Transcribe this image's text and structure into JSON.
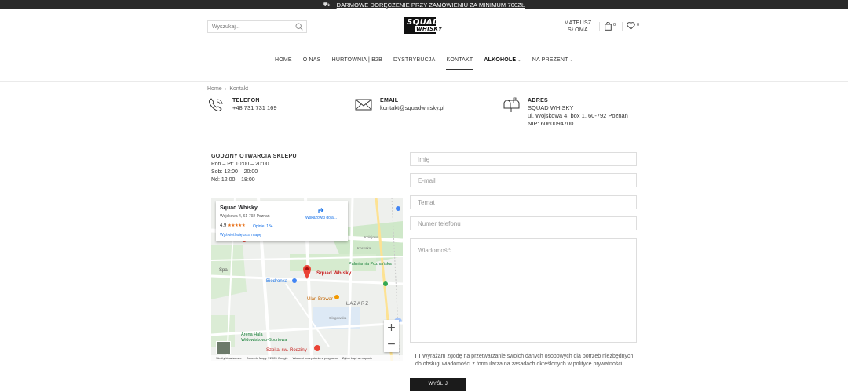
{
  "topbar": {
    "promo": "DARMOWE DORĘCZENIE PRZY ZAMÓWIENIU ZA MINIMUM 700ZŁ"
  },
  "header": {
    "search_placeholder": "Wyszukaj...",
    "logo": {
      "line1": "SQUAD",
      "line2": "WHISKY"
    },
    "user": {
      "first": "MATEUSZ",
      "last": "SŁOMA"
    },
    "cart_count": "0",
    "wishlist_count": "0"
  },
  "nav": [
    {
      "label": "HOME"
    },
    {
      "label": "O NAS"
    },
    {
      "label": "HURTOWNIA | B2B"
    },
    {
      "label": "DYSTRYBUCJA"
    },
    {
      "label": "KONTAKT"
    },
    {
      "label": "ALKOHOLE"
    },
    {
      "label": "NA PREZENT"
    }
  ],
  "breadcrumb": {
    "home": "Home",
    "current": "Kontakt"
  },
  "contact": {
    "phone": {
      "label": "TELEFON",
      "value": "+48 731 731 169"
    },
    "email": {
      "label": "EMAIL",
      "value": "kontakt@squadwhisky.pl"
    },
    "address": {
      "label": "ADRES",
      "line1": "SQUAD WHISKY",
      "line2": "ul. Wojskowa 4, box 1. 60-792 Poznań",
      "line3": "NIP: 6060094700"
    }
  },
  "hours": {
    "title": "GODZINY OTWARCIA SKLEPU",
    "l1": "Pon – Pt: 10:00 – 20:00",
    "l2": "Sob: 12:00 – 20:00",
    "l3": "Nd: 12:00 – 18:00"
  },
  "map": {
    "place": "Squad Whisky",
    "address": "Wojskowa 4, 61-792 Poznań",
    "rating": "4,9",
    "stars": "★★★★★",
    "reviews": "Opinie: 134",
    "bigger": "Wyświetl większą mapę",
    "directions": "Wskazówki doja...",
    "pin_label": "Squad Whisky",
    "labels": {
      "biedronka": "Biedronka",
      "ulan": "Ulan Browar",
      "palmiarnia": "Palmiarnia Poznańska",
      "spa": "Spa",
      "arena": "Arena Hala\nWidowiskowo-Sportowa",
      "szpital": "Szpital św. Rodziny",
      "lazarz": "ŁAZARZ",
      "kolejowa": "Kolejowa",
      "kossaka": "Kossaka",
      "glogowska": "Głogowska"
    },
    "footer": [
      "Skróty klawiszowe",
      "Dane do Mapy ©2023 Google",
      "Warunki korzystania z programu",
      "Zgłoś błąd w mapach"
    ],
    "zoom_in": "+",
    "zoom_out": "−"
  },
  "form": {
    "name": "Imię",
    "email": "E-mail",
    "subject": "Temat",
    "phone": "Numer telefonu",
    "message": "Wiadomość",
    "consent": "Wyrażam zgodę na przetwarzanie swoich danych osobowych dla potrzeb niezbędnych do obsługi wiadomości z formularza na zasadach określonych w polityce prywatności.",
    "submit": "WYŚLIJ"
  }
}
